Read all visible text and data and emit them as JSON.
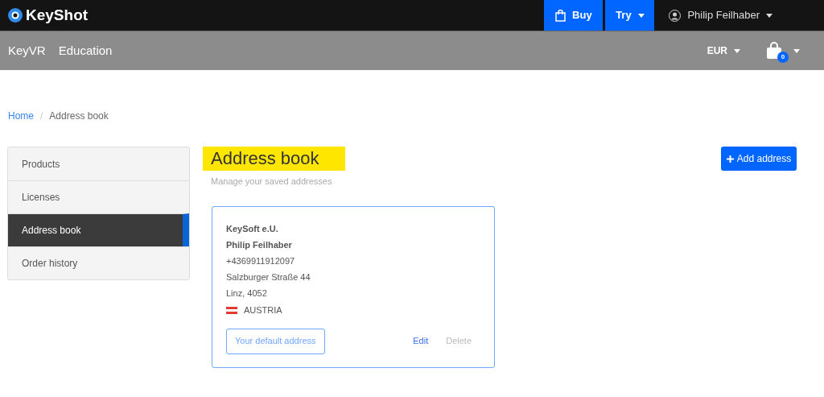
{
  "topbar": {
    "logo": "KeyShot",
    "buy": "Buy",
    "try": "Try",
    "user": "Philip Feilhaber"
  },
  "navbar": {
    "links": [
      "KeyVR",
      "Education"
    ],
    "currency": "EUR",
    "cart_count": "0"
  },
  "breadcrumb_separator": "/",
  "breadcrumb": [
    {
      "label": "Home",
      "link": true
    },
    {
      "label": "Address book",
      "link": false
    }
  ],
  "sidebar": {
    "items": [
      {
        "label": "Products",
        "selected": false
      },
      {
        "label": "Licenses",
        "selected": false
      },
      {
        "label": "Address book",
        "selected": true
      },
      {
        "label": "Order history",
        "selected": false
      }
    ]
  },
  "page": {
    "title": "Address book",
    "highlighted": true,
    "subtitle": "Manage your saved addresses",
    "add_button": "Add address"
  },
  "addresses": [
    {
      "company": "KeySoft e.U.",
      "name": "Philip Feilhaber",
      "phone": "+4369911912097",
      "street": "Salzburger Straße 44",
      "city": "Linz, 4052",
      "country": "AUSTRIA",
      "default": true,
      "default_label": "Your default address",
      "actions": [
        {
          "label": "Edit",
          "disabled": false
        },
        {
          "label": "Delete",
          "disabled": true
        }
      ]
    }
  ]
}
